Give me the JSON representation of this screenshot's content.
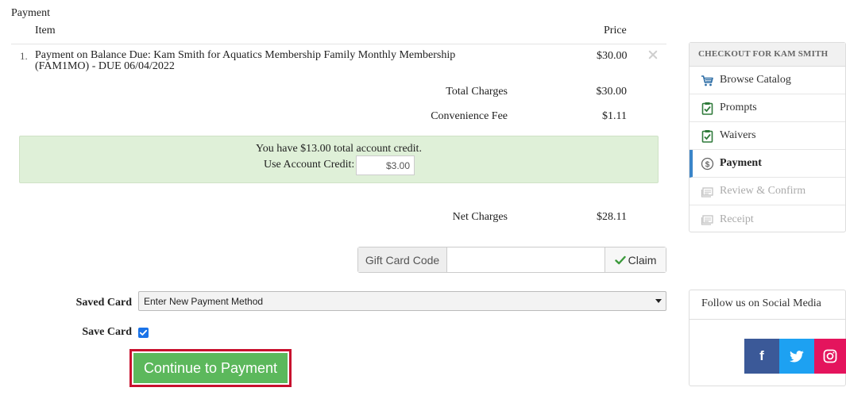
{
  "section_title": "Payment",
  "table": {
    "col_item": "Item",
    "col_price": "Price",
    "rows": [
      {
        "number": "1.",
        "description": "Payment on Balance Due: Kam Smith for Aquatics Membership Family Monthly Membership (FAM1MO) - DUE 06/04/2022",
        "price": "$30.00"
      }
    ]
  },
  "summary": {
    "total_label": "Total Charges",
    "total_value": "$30.00",
    "fee_label": "Convenience Fee",
    "fee_value": "$1.11",
    "net_label": "Net Charges",
    "net_value": "$28.11"
  },
  "credit": {
    "message": "You have $13.00 total account credit.",
    "use_label": "Use Account Credit:",
    "use_value": "$3.00"
  },
  "gift_card": {
    "label": "Gift Card Code",
    "value": "",
    "claim_label": "Claim"
  },
  "saved_card": {
    "label": "Saved Card",
    "selected": "Enter New Payment Method"
  },
  "save_card": {
    "label": "Save Card",
    "checked": true
  },
  "continue_label": "Continue to Payment",
  "checkout": {
    "heading": "CHECKOUT FOR KAM SMITH",
    "steps": [
      {
        "label": "Browse Catalog",
        "icon": "cart-icon",
        "state": "normal"
      },
      {
        "label": "Prompts",
        "icon": "clipboard-check-icon",
        "state": "normal"
      },
      {
        "label": "Waivers",
        "icon": "clipboard-check-icon",
        "state": "normal"
      },
      {
        "label": "Payment",
        "icon": "dollar-circle-icon",
        "state": "active"
      },
      {
        "label": "Review & Confirm",
        "icon": "ticket-icon",
        "state": "disabled"
      },
      {
        "label": "Receipt",
        "icon": "ticket-icon",
        "state": "disabled"
      }
    ]
  },
  "social": {
    "heading": "Follow us on Social Media",
    "facebook_glyph": "f",
    "facebook_color": "#3b5998",
    "twitter_color": "#1da1f2",
    "instagram_color": "#e4145d"
  },
  "colors": {
    "continue_button": "#5cb85c",
    "highlight_outline": "#c8102e",
    "credit_background": "#dff0d8",
    "active_step_accent": "#3a85c9"
  }
}
